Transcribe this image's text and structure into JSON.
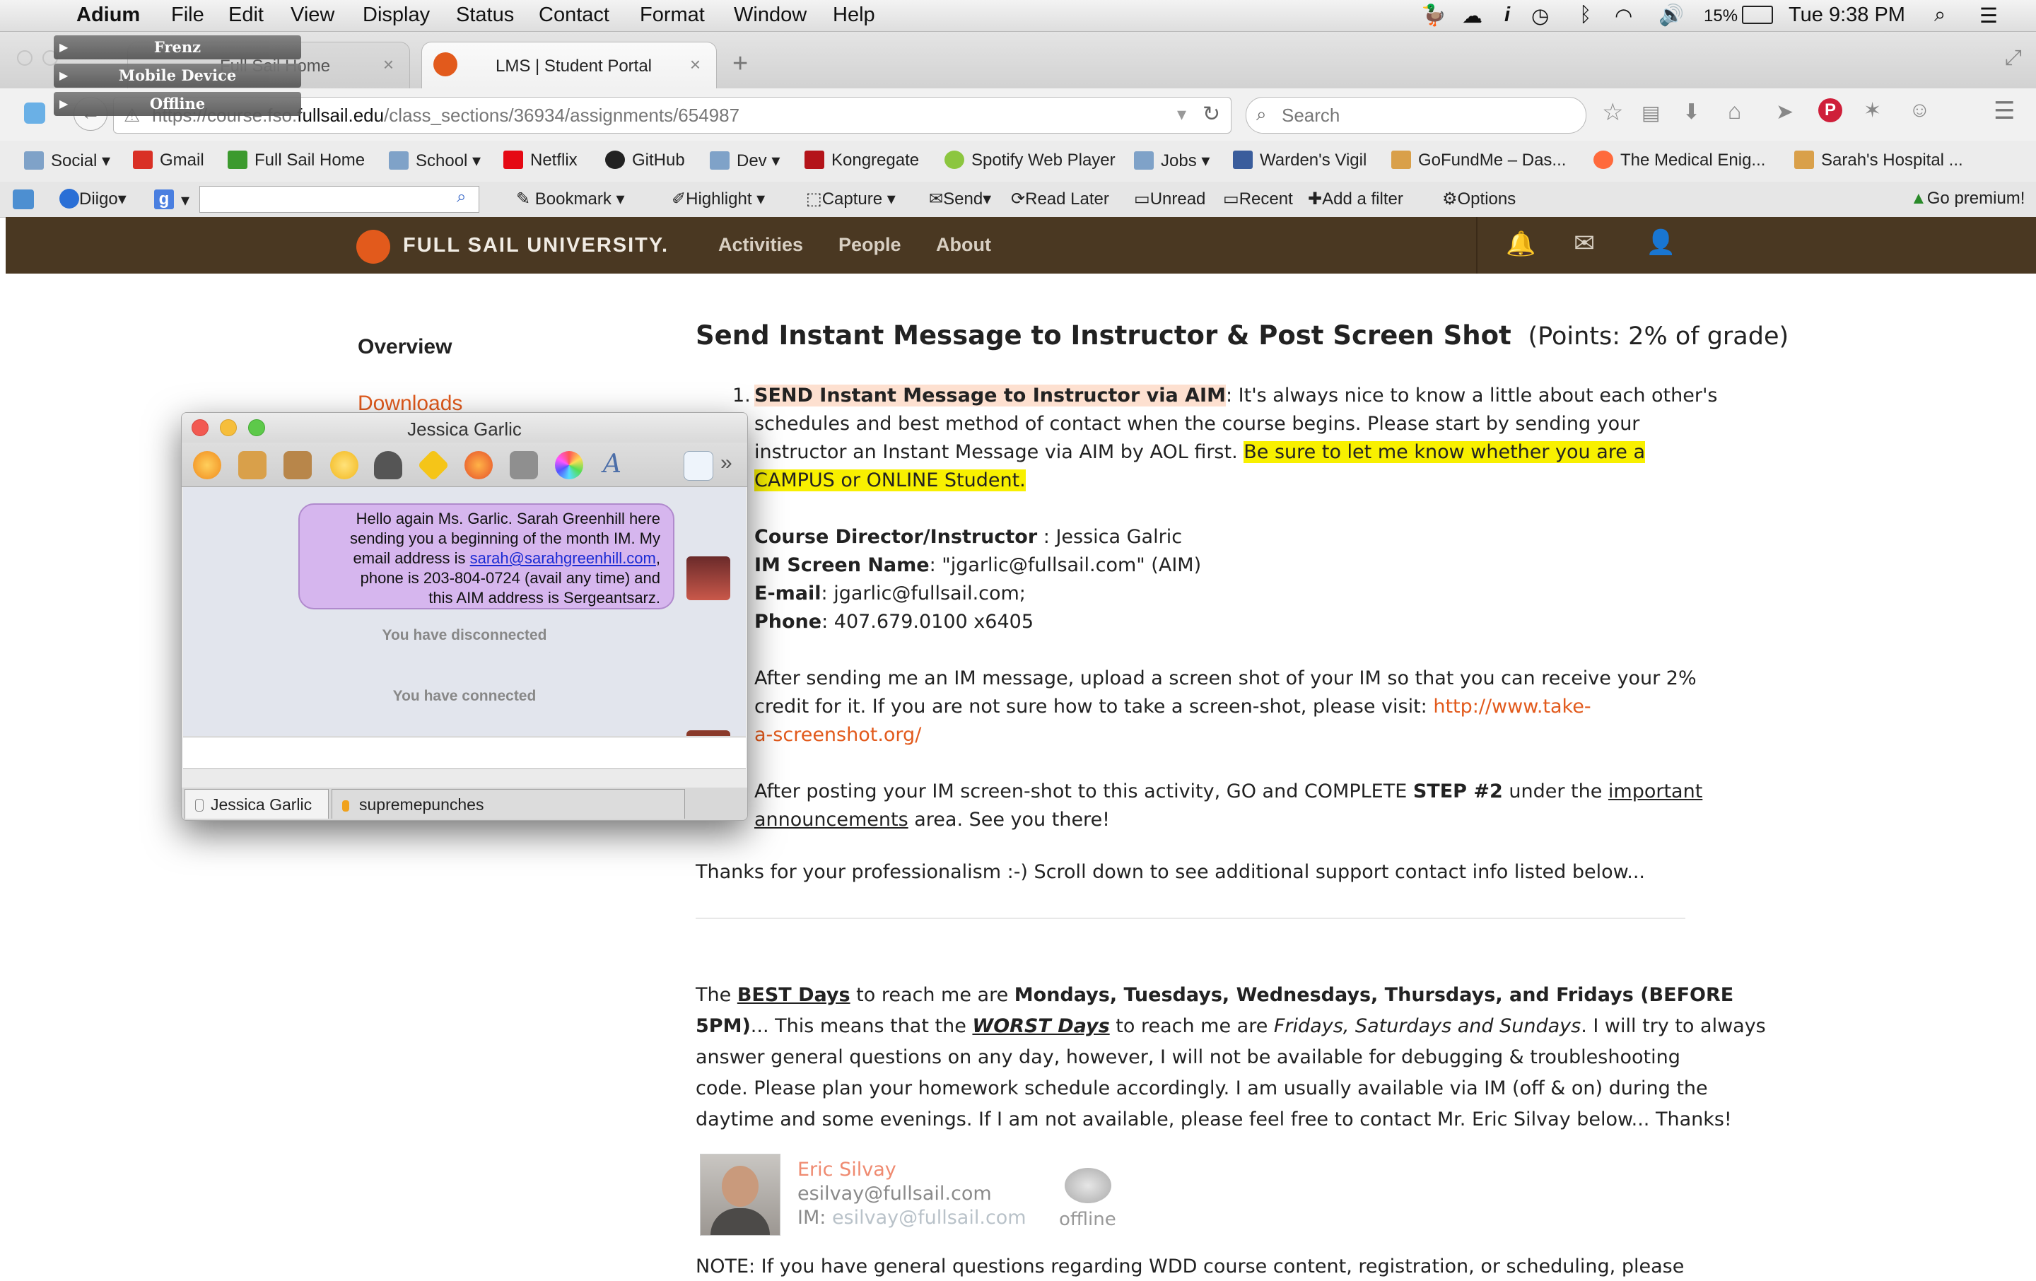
{
  "menubar": {
    "app_name": "Adium",
    "items": [
      "File",
      "Edit",
      "View",
      "Display",
      "Status",
      "Contact",
      "Format",
      "Window",
      "Help"
    ],
    "battery": "15%",
    "clock": "Tue 9:38 PM"
  },
  "contact_list": {
    "groups": [
      "Frenz",
      "Mobile Device",
      "Offline"
    ]
  },
  "browser": {
    "tabs": [
      {
        "label": "Full Sail Home",
        "active": false
      },
      {
        "label": "LMS | Student Portal",
        "active": true
      }
    ],
    "url_prefix": "https://course.fso.",
    "url_domain": "fullsail.edu",
    "url_path": "/class_sections/36934/assignments/654987",
    "search_placeholder": "Search",
    "bookmarks": [
      {
        "label": "Social",
        "icon": "folder-icon",
        "dropdown": true
      },
      {
        "label": "Gmail",
        "icon": "gmail-icon",
        "dropdown": false
      },
      {
        "label": "Full Sail Home",
        "icon": "fullsail-icon",
        "dropdown": false
      },
      {
        "label": "School",
        "icon": "folder-icon",
        "dropdown": true
      },
      {
        "label": "Netflix",
        "icon": "netflix-icon",
        "dropdown": false
      },
      {
        "label": "GitHub",
        "icon": "github-icon",
        "dropdown": false
      },
      {
        "label": "Dev",
        "icon": "folder-icon",
        "dropdown": true
      },
      {
        "label": "Kongregate",
        "icon": "kongregate-icon",
        "dropdown": false
      },
      {
        "label": "Spotify Web Player",
        "icon": "spotify-icon",
        "dropdown": false
      },
      {
        "label": "Jobs",
        "icon": "folder-icon",
        "dropdown": true
      },
      {
        "label": "Warden's Vigil",
        "icon": "site-icon",
        "dropdown": false
      },
      {
        "label": "GoFundMe – Das...",
        "icon": "gofundme-icon",
        "dropdown": false
      },
      {
        "label": "The Medical Enig...",
        "icon": "reddit-icon",
        "dropdown": false
      },
      {
        "label": "Sarah's Hospital ...",
        "icon": "gofundme-icon",
        "dropdown": false
      }
    ],
    "diigo_toolbar": {
      "brand": "Diigo",
      "items": [
        "Bookmark",
        "Highlight",
        "Capture",
        "Send",
        "Read Later",
        "Unread",
        "Recent",
        "Add a filter",
        "Options"
      ],
      "premium": "Go premium!"
    }
  },
  "site": {
    "logo_text": "FULL SAIL UNIVERSITY.",
    "nav": [
      "Activities",
      "People",
      "About"
    ],
    "sidebar": {
      "overview": "Overview",
      "downloads": "Downloads"
    },
    "assignment": {
      "title": "Send Instant Message to Instructor & Post Screen Shot",
      "points": "(Points: 2% of grade)",
      "step1_number": "1.",
      "step1_heading": "SEND Instant Message to Instructor via AIM",
      "step1_text_a": ":  It's always nice to know a little about each other's",
      "step1_text_b": "schedules and best method of contact when the course begins. Please start by sending your",
      "step1_text_c": "instructor an Instant Message via AIM by AOL first.",
      "step1_highlight_a": "Be sure to let me know whether you are a",
      "step1_highlight_b": "CAMPUS or ONLINE Student.",
      "contact": {
        "director_label": "Course Director/Instructor",
        "director_value": " : Jessica Galric",
        "screen_label": "IM Screen Name",
        "screen_value": ": \"jgarlic@fullsail.com\" (AIM)",
        "email_label": "E-mail",
        "email_value": ": jgarlic@fullsail.com;",
        "phone_label": "Phone",
        "phone_value": ":  407.679.0100 x6405"
      },
      "step2_a": "After sending me an IM message, upload a screen shot of your IM so that you can receive your 2%",
      "step2_b": "credit for it.  If you are not sure how to take a screen-shot, please visit:",
      "step2_link_a": "http://www.take-",
      "step2_link_b": "a-screenshot.org/",
      "step3_a": "After posting your IM screen-shot to this activity, GO and COMPLETE",
      "step3_bold": "STEP #2",
      "step3_b": " under the ",
      "step3_link_a": "important",
      "step3_link_b": "announcements",
      "step3_c": " area.  See you there!",
      "thanks": "Thanks for your professionalism :-) Scroll down to see additional support contact info listed below...",
      "best_a": "The ",
      "best_days": "BEST Days",
      "best_b": " to reach me are ",
      "best_days_list": "Mondays, Tuesdays, Wednesdays, Thursdays, and Fridays (BEFORE",
      "best_c": "5PM)",
      "best_d": "... This means that the ",
      "worst_days": "WORST Days",
      "best_e": " to reach me are ",
      "worst_list": "Fridays, Saturdays and Sundays",
      "best_f": ".  I will try to always",
      "line3": "answer general questions on any day, however, I will not be available for debugging & troubleshooting",
      "line4": "code.  Please plan your homework schedule accordingly.   I am usually available via IM (off & on) during the",
      "line5": "daytime and some evenings.  If I am not available, please feel free to contact Mr. Eric Silvay below... Thanks!",
      "support": {
        "name": "Eric Silvay",
        "email": "esilvay@fullsail.com",
        "im_label": "IM: ",
        "im_value": "esilvay@fullsail.com",
        "status": "offline"
      },
      "note": "NOTE: If you have general questions regarding WDD course content, registration, or scheduling, please"
    }
  },
  "chat_window": {
    "title": "Jessica Garlic",
    "message_a": "Hello again Ms. Garlic. Sarah Greenhill here",
    "message_b": "sending you a beginning of the month IM. My",
    "message_c_prefix": "email address is ",
    "message_email": "sarah@sarahgreenhill.com",
    "message_c_suffix": ",",
    "message_d": "phone is 203-804-0724 (avail any time) and",
    "message_e": "this AIM address is Sergeantsarz.",
    "status_disconnected": "You have disconnected",
    "status_connected": "You have connected",
    "tabs": [
      "Jessica Garlic",
      "supremepunches"
    ]
  },
  "colors": {
    "header_brown": "#4a3822",
    "accent_orange": "#e25a1c",
    "highlight_yellow": "#f8f000",
    "bubble_purple": "#d6b6ee"
  }
}
